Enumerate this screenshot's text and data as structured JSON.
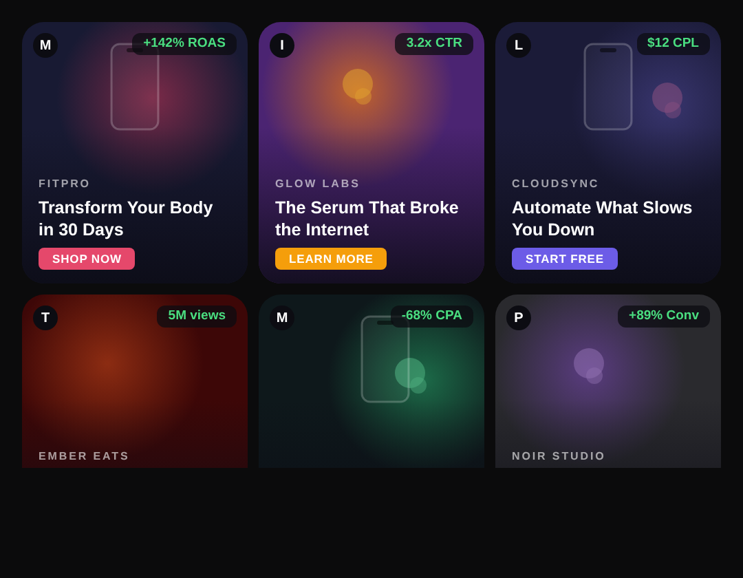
{
  "cards": [
    {
      "avatar": "M",
      "metric": "+142% ROAS",
      "brand": "FITPRO",
      "headline": "Transform Your Body in 30 Days",
      "button": {
        "label": "SHOP NOW",
        "color": "#e5486b"
      }
    },
    {
      "avatar": "I",
      "metric": "3.2x CTR",
      "brand": "GLOW LABS",
      "headline": "The Serum That Broke the Internet",
      "button": {
        "label": "LEARN MORE",
        "color": "#f59e0b"
      }
    },
    {
      "avatar": "L",
      "metric": "$12 CPL",
      "brand": "CLOUDSYNC",
      "headline": "Automate What Slows You Down",
      "button": {
        "label": "START FREE",
        "color": "#6c5ce7"
      }
    },
    {
      "avatar": "T",
      "metric": "5M views",
      "brand": "EMBER EATS"
    },
    {
      "avatar": "M",
      "metric": "-68% CPA"
    },
    {
      "avatar": "P",
      "metric": "+89% Conv",
      "brand": "NOIR STUDIO"
    }
  ]
}
